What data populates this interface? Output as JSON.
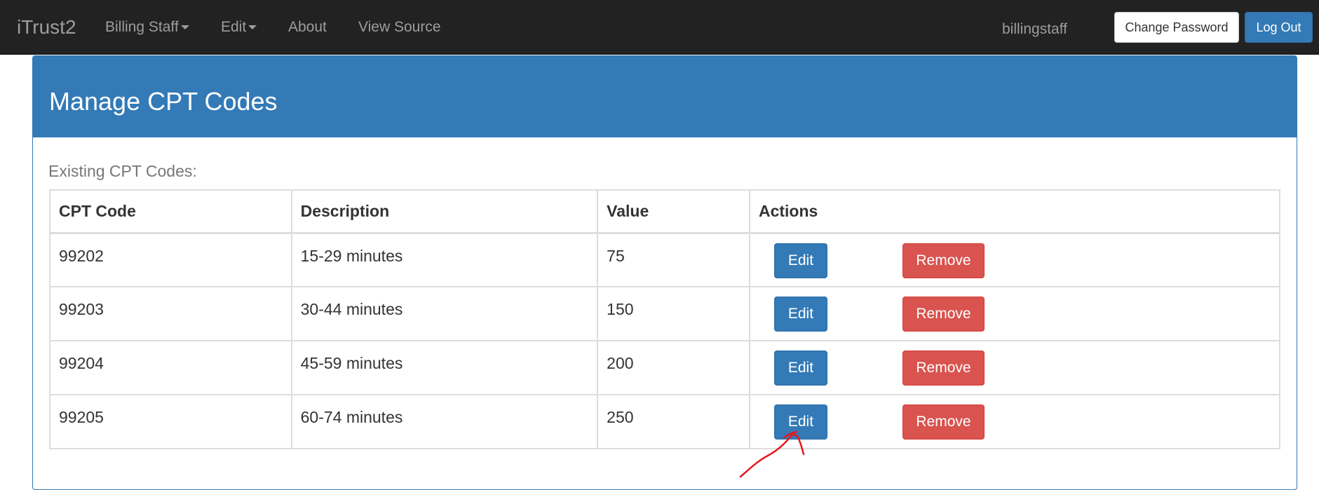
{
  "navbar": {
    "brand": "iTrust2",
    "menu_billing": "Billing Staff",
    "menu_edit": "Edit",
    "link_about": "About",
    "link_view_source": "View Source",
    "username": "billingstaff",
    "change_password_label": "Change Password",
    "logout_label": "Log Out"
  },
  "panel": {
    "title": "Manage CPT Codes",
    "caption": "Existing CPT Codes:"
  },
  "table": {
    "headers": [
      "CPT Code",
      "Description",
      "Value",
      "Actions"
    ],
    "rows": [
      {
        "code": "99202",
        "description": "15-29 minutes",
        "value": "75",
        "edit_label": "Edit",
        "remove_label": "Remove"
      },
      {
        "code": "99203",
        "description": "30-44 minutes",
        "value": "150",
        "edit_label": "Edit",
        "remove_label": "Remove"
      },
      {
        "code": "99204",
        "description": "45-59 minutes",
        "value": "200",
        "edit_label": "Edit",
        "remove_label": "Remove"
      },
      {
        "code": "99205",
        "description": "60-74 minutes",
        "value": "250",
        "edit_label": "Edit",
        "remove_label": "Remove"
      }
    ]
  },
  "colors": {
    "navbar_bg": "#222222",
    "primary": "#337ab7",
    "danger": "#d9534f",
    "annotation": "#e8161b"
  }
}
